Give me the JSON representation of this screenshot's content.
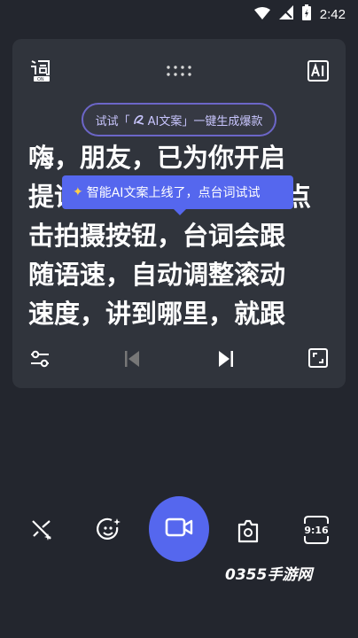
{
  "status_bar": {
    "time": "2:42"
  },
  "prompter": {
    "ai_pill_prefix": "试试「",
    "ai_pill_name": "AI文案",
    "ai_pill_suffix": "」一键生成爆款",
    "script_lines": [
      "嗨，朋友，已为你开启",
      "提词器，点击拍摄按钮点",
      "击拍摄按钮，台词会跟",
      "随语速，自动调整滚动",
      "速度，讲到哪里，就跟"
    ],
    "tooltip_text": "智能AI文案上线了，点台词试试"
  },
  "bottom_bar": {
    "aspect_label": "9:16"
  },
  "watermark": "0355手游网",
  "colors": {
    "accent": "#5567ee",
    "panel": "#30343c",
    "background": "#23262e"
  }
}
